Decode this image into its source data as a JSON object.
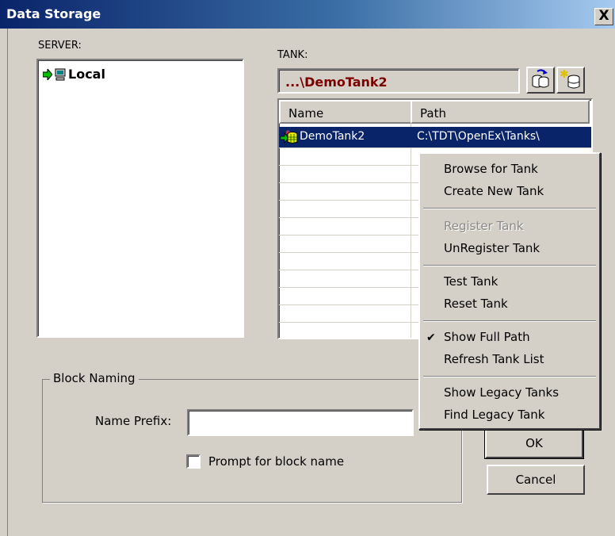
{
  "window": {
    "title": "Data Storage",
    "close_glyph": "X"
  },
  "server": {
    "label": "SERVER:",
    "items": [
      {
        "name": "Local",
        "icon": "computer-icon"
      }
    ]
  },
  "tank": {
    "label": "TANK:",
    "current": "...\\DemoTank2",
    "tools": [
      {
        "icon": "browse-tank-icon"
      },
      {
        "icon": "new-tank-icon"
      }
    ],
    "columns": [
      "Name",
      "Path"
    ],
    "rows": [
      {
        "name": "DemoTank2",
        "path": "C:\\TDT\\OpenEx\\Tanks\\"
      }
    ]
  },
  "block_naming": {
    "title": "Block Naming",
    "name_prefix_label": "Name Prefix:",
    "name_prefix_value": "",
    "prompt_label": "Prompt for block name",
    "prompt_checked": false
  },
  "buttons": {
    "ok": "OK",
    "cancel": "Cancel"
  },
  "context_menu": {
    "items": [
      {
        "label": "Browse for Tank",
        "enabled": true
      },
      {
        "label": "Create New Tank",
        "enabled": true
      },
      {
        "label": "Register Tank",
        "enabled": false
      },
      {
        "label": "UnRegister Tank",
        "enabled": true
      },
      {
        "label": "Test Tank",
        "enabled": true
      },
      {
        "label": "Reset Tank",
        "enabled": true
      },
      {
        "label": "Show Full Path",
        "enabled": true,
        "checked": true
      },
      {
        "label": "Refresh Tank List",
        "enabled": true
      },
      {
        "label": "Show Legacy Tanks",
        "enabled": true
      },
      {
        "label": "Find Legacy Tank",
        "enabled": true
      }
    ]
  }
}
